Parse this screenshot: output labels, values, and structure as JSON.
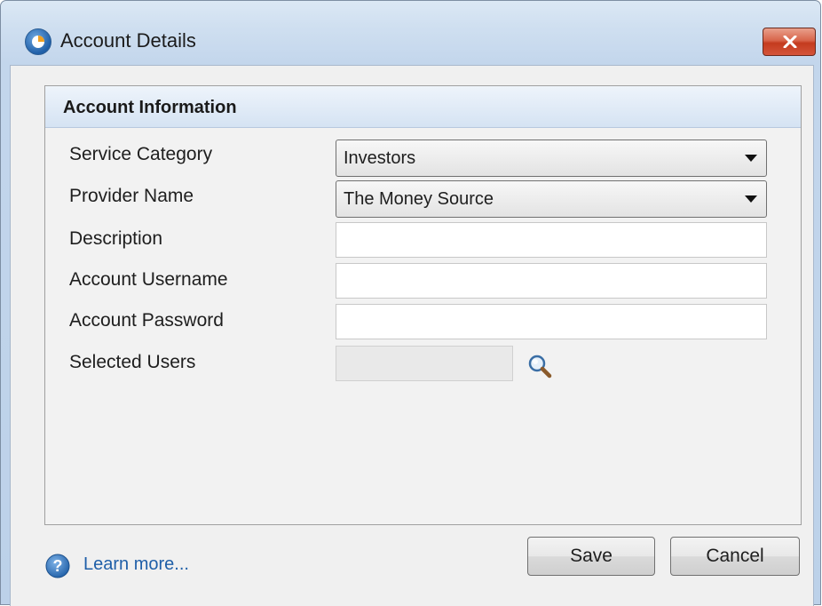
{
  "window": {
    "title": "Account Details",
    "close_icon": "close-x-icon"
  },
  "group": {
    "title": "Account Information"
  },
  "form": {
    "service_category": {
      "label": "Service Category",
      "value": "Investors"
    },
    "provider_name": {
      "label": "Provider Name",
      "value": "The Money Source"
    },
    "description": {
      "label": "Description",
      "value": ""
    },
    "account_username": {
      "label": "Account Username",
      "value": ""
    },
    "account_password": {
      "label": "Account Password",
      "value": ""
    },
    "selected_users": {
      "label": "Selected Users",
      "value": "",
      "icon": "magnifier-icon"
    }
  },
  "footer": {
    "help_icon": "help-icon",
    "learn_more": "Learn more...",
    "save": "Save",
    "cancel": "Cancel"
  },
  "colors": {
    "link": "#1f5fa8",
    "close_button": "#c43b1e",
    "header_band": "#d5e3f3"
  }
}
